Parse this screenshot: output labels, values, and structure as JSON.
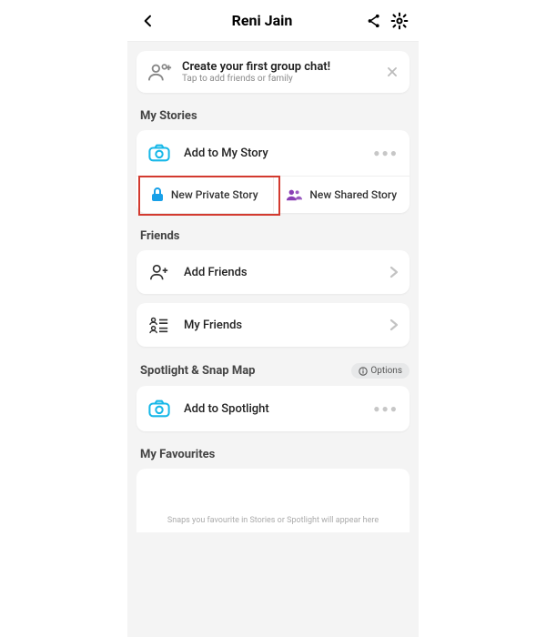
{
  "header": {
    "title": "Reni Jain"
  },
  "banner": {
    "title": "Create your first group chat!",
    "subtitle": "Tap to add friends or family"
  },
  "sections": {
    "stories": {
      "title": "My Stories",
      "add_label": "Add to My Story",
      "private_label": "New Private Story",
      "shared_label": "New Shared Story"
    },
    "friends": {
      "title": "Friends",
      "add_label": "Add Friends",
      "my_label": "My Friends"
    },
    "spotlight": {
      "title": "Spotlight & Snap Map",
      "options_label": "Options",
      "add_label": "Add to Spotlight"
    },
    "favourites": {
      "title": "My Favourites",
      "empty_text": "Snaps you favourite in Stories or Spotlight will appear here"
    }
  },
  "colors": {
    "accent_cyan": "#18b8e8",
    "lock_blue": "#18a0e8",
    "people_purple": "#8a3fb5",
    "highlight_red": "#d33a2f"
  }
}
